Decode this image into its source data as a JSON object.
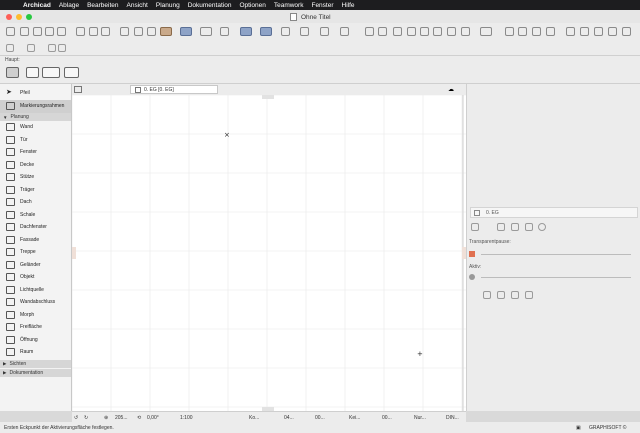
{
  "menubar": {
    "app": "Archicad",
    "items": [
      "Ablage",
      "Bearbeiten",
      "Ansicht",
      "Planung",
      "Dokumentation",
      "Optionen",
      "Teamwork",
      "Fenster",
      "Hilfe"
    ]
  },
  "window": {
    "title": "Ohne Titel"
  },
  "infobox": {
    "label": "Haupt:"
  },
  "toolbox": {
    "items": [
      {
        "label": "Pfeil",
        "icon": "arrow-icon"
      },
      {
        "label": "Markierungsrahmen",
        "icon": "marquee-icon"
      }
    ],
    "sections": [
      {
        "label": "Planung",
        "expanded": true,
        "items": [
          {
            "label": "Wand",
            "icon": "wall-icon"
          },
          {
            "label": "Tür",
            "icon": "door-icon"
          },
          {
            "label": "Fenster",
            "icon": "window-icon"
          },
          {
            "label": "Decke",
            "icon": "slab-icon"
          },
          {
            "label": "Stütze",
            "icon": "column-icon"
          },
          {
            "label": "Träger",
            "icon": "beam-icon"
          },
          {
            "label": "Dach",
            "icon": "roof-icon"
          },
          {
            "label": "Schale",
            "icon": "shell-icon"
          },
          {
            "label": "Dachfenster",
            "icon": "skylight-icon"
          },
          {
            "label": "Fassade",
            "icon": "curtain-wall-icon"
          },
          {
            "label": "Treppe",
            "icon": "stair-icon"
          },
          {
            "label": "Geländer",
            "icon": "railing-icon"
          },
          {
            "label": "Objekt",
            "icon": "object-icon"
          },
          {
            "label": "Lichtquelle",
            "icon": "lamp-icon"
          },
          {
            "label": "Wandabschluss",
            "icon": "wall-end-icon"
          },
          {
            "label": "Morph",
            "icon": "morph-icon"
          },
          {
            "label": "Freifläche",
            "icon": "zone-icon"
          },
          {
            "label": "Öffnung",
            "icon": "opening-icon"
          },
          {
            "label": "Raum",
            "icon": "room-icon"
          }
        ]
      },
      {
        "label": "Sichten",
        "expanded": false
      },
      {
        "label": "Dokumentation",
        "expanded": false
      }
    ]
  },
  "view": {
    "tab_label": "0. EG [0. EG]"
  },
  "panel": {
    "story_label": "0. EG",
    "transparent_label": "Transparentpause:",
    "active_label": "Aktiv:"
  },
  "statusbar": {
    "zoom": "205...",
    "angle": "0,00°",
    "scale": "1:100",
    "layer": "Ko...",
    "pen": "04...",
    "model": "00...",
    "renovation": "Kei...",
    "struct": "00...",
    "filter": "Nur...",
    "dimension": "DIN..."
  },
  "hint": {
    "text": "Ersten Eckpunkt der Aktivierungsfläche festlegen.",
    "brand": "GRAPHISOFT ©"
  },
  "colors": {
    "menubar_bg": "#1d1d1f",
    "light_red": "#fe5f57",
    "light_yellow": "#febc2e",
    "light_green": "#28c840",
    "toolbar_selected_brown": "#c9a98a",
    "toolbar_selected_blue": "#8ea3c7",
    "grid_line": "#e8e8e8"
  }
}
